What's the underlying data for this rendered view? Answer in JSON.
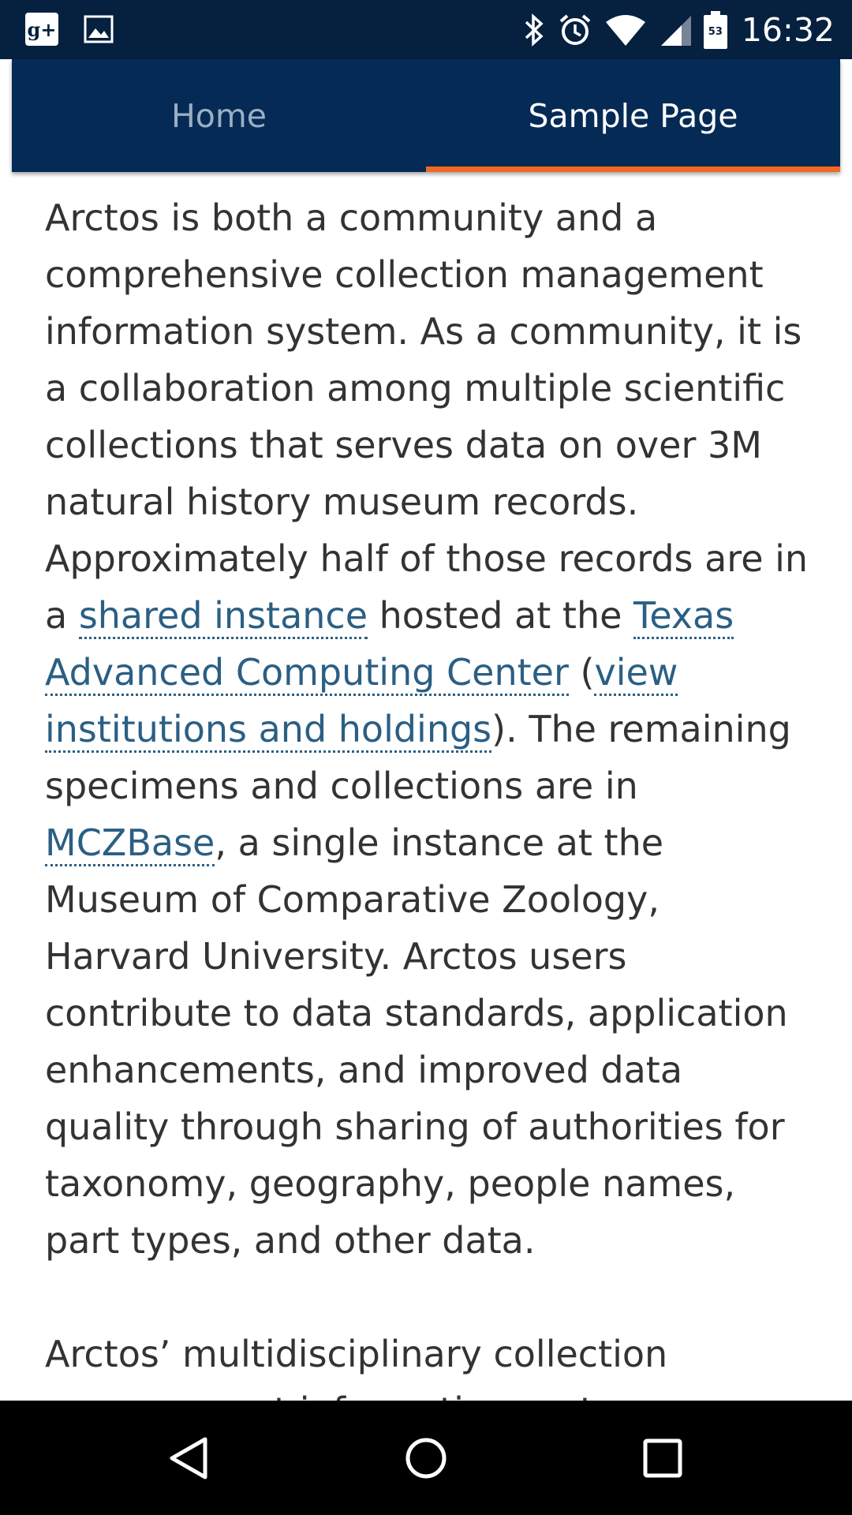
{
  "status_bar": {
    "time": "16:32",
    "battery_level": "53",
    "left_icons": [
      "google-plus-icon",
      "image-notification-icon"
    ],
    "right_icons": [
      "bluetooth-icon",
      "alarm-icon",
      "wifi-icon",
      "cell-signal-icon",
      "battery-icon"
    ]
  },
  "tabs": {
    "items": [
      {
        "label": "Home"
      },
      {
        "label": "Sample Page"
      }
    ],
    "active": "Sample Page",
    "indicator_color": "#f26722"
  },
  "content": {
    "p1": {
      "t1": "Arctos is both a community and a comprehensive collection management information system. As a community, it is a collaboration among multiple scientific collections that serves data on over 3M natural history museum records. Approximately half of those records are in a ",
      "link_shared_instance": "shared instance",
      "t2": " hosted at the ",
      "link_tacc": "Texas Advanced Computing Center",
      "t3": " (",
      "link_view_institutions": "view institutions and holdings",
      "t4": "). The remaining specimens and collections are in ",
      "link_mczbase": "MCZBase",
      "t5": ", a single instance at the Museum of Comparative Zoology, Harvard University. Arctos users contribute to data standards, application enhancements, and improved data quality through sharing of authorities for taxonomy, geography, people names, part types, and other data."
    },
    "p2": "Arctos’ multidisciplinary collection management information system integrates access to diverse types of"
  },
  "nav_bar": {
    "buttons": [
      "back-icon",
      "home-icon",
      "recents-icon"
    ]
  },
  "colors": {
    "status_bar_bg": "#06203f",
    "tab_bar_bg": "#052a55",
    "link": "#2b5f84",
    "body_text": "#333333"
  }
}
